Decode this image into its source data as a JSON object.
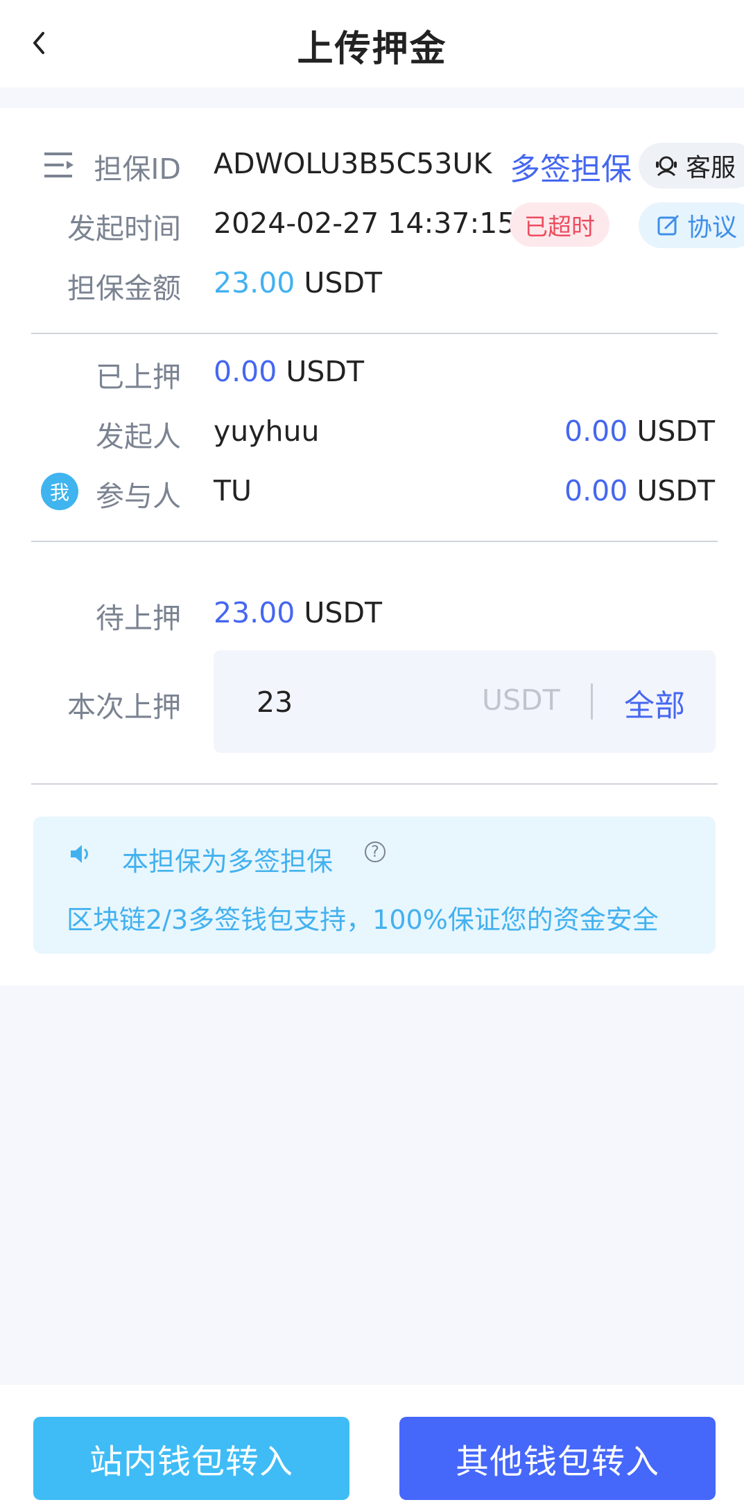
{
  "header": {
    "title": "上传押金"
  },
  "info": {
    "id_label": "担保ID",
    "id_value": "ADWOLU3B5C53UK",
    "type_tag": "多签担保",
    "kefu_label": "客服",
    "time_label": "发起时间",
    "time_value": "2024-02-27 14:37:15",
    "status_badge": "已超时",
    "protocol_label": "协议",
    "amount_label": "担保金额",
    "amount_value": "23.00",
    "amount_unit": "USDT"
  },
  "deposits": {
    "deposited_label": "已上押",
    "deposited_value": "0.00",
    "deposited_unit": "USDT",
    "initiator_label": "发起人",
    "initiator_name": "yuyhuu",
    "initiator_amount": "0.00",
    "initiator_unit": "USDT",
    "me_badge": "我",
    "participant_label": "参与人",
    "participant_name": "TU",
    "participant_amount": "0.00",
    "participant_unit": "USDT"
  },
  "pending": {
    "pending_label": "待上押",
    "pending_value": "23.00",
    "pending_unit": "USDT",
    "current_label": "本次上押",
    "current_input": "23",
    "input_unit": "USDT",
    "all_label": "全部"
  },
  "notice": {
    "title": "本担保为多签担保",
    "help": "?",
    "desc": "区块链2/3多签钱包支持，100%保证您的资金安全"
  },
  "footer": {
    "inner_wallet": "站内钱包转入",
    "other_wallet": "其他钱包转入"
  }
}
